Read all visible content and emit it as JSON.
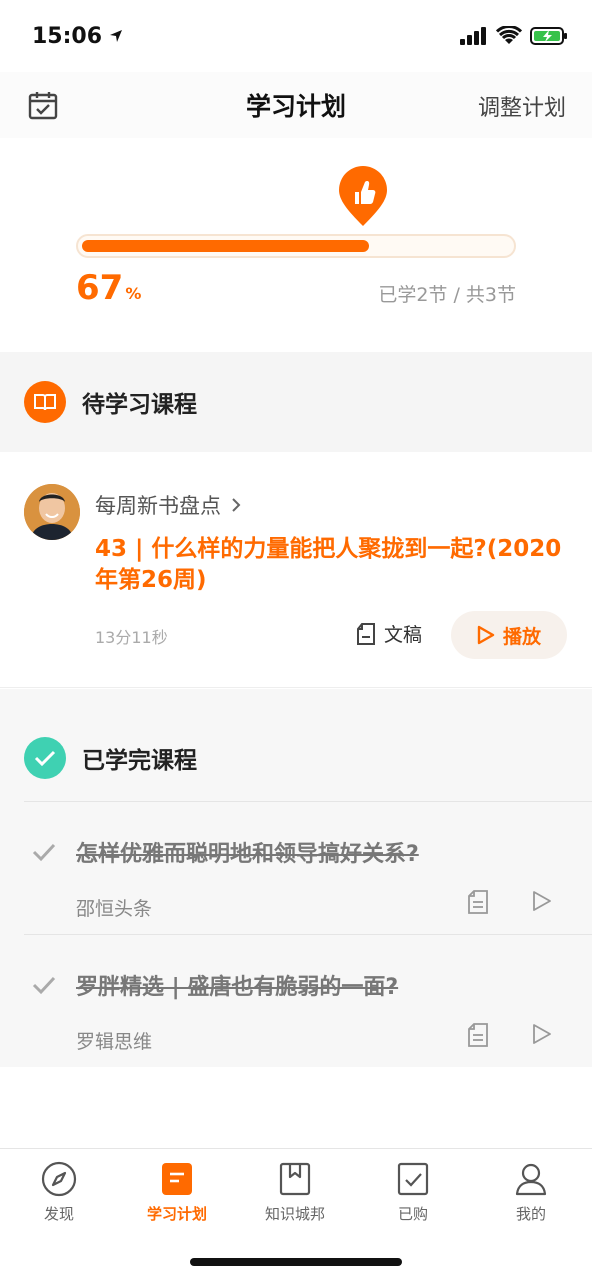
{
  "status_bar": {
    "time": "15:06"
  },
  "nav": {
    "title": "学习计划",
    "right_action": "调整计划"
  },
  "progress": {
    "percent_value": "67",
    "percent_unit": "%",
    "fraction": 0.67,
    "count_text": "已学2节 / 共3节"
  },
  "pending": {
    "section_title": "待学习课程",
    "course": {
      "series": "每周新书盘点",
      "title": "43 | 什么样的力量能把人聚拢到一起?(2020年第26周)",
      "duration": "13分11秒",
      "doc_label": "文稿",
      "play_label": "播放"
    }
  },
  "completed": {
    "section_title": "已学完课程",
    "items": [
      {
        "title": "怎样优雅而聪明地和领导搞好关系?",
        "source": "邵恒头条"
      },
      {
        "title": "罗胖精选 | 盛唐也有脆弱的一面?",
        "source": "罗辑思维"
      }
    ]
  },
  "tabs": [
    {
      "label": "发现",
      "icon": "compass-icon"
    },
    {
      "label": "学习计划",
      "icon": "plan-icon",
      "active": true
    },
    {
      "label": "知识城邦",
      "icon": "bookmark-icon"
    },
    {
      "label": "已购",
      "icon": "purchased-icon"
    },
    {
      "label": "我的",
      "icon": "person-icon"
    }
  ],
  "colors": {
    "accent": "#ff6a00",
    "done_green": "#3fd1b2"
  }
}
